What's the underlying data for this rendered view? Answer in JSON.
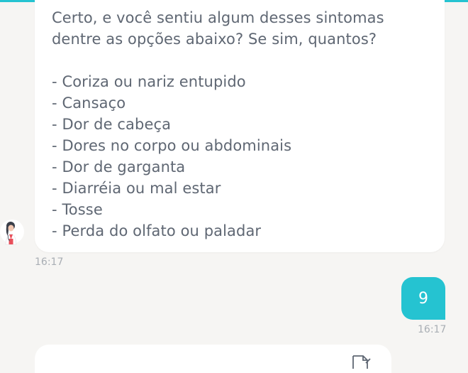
{
  "colors": {
    "accent": "#25c3d1",
    "bot_text": "#5f6773",
    "timestamp": "#a9aeb4",
    "background": "#f6f5f3"
  },
  "bot_message": {
    "question_line1": "Certo, e você sentiu algum desses sintomas",
    "question_line2": "dentre as opções abaixo? Se sim, quantos?",
    "options": [
      "- Coriza ou nariz entupido",
      "- Cansaço",
      "- Dor de cabeça",
      "- Dores no corpo ou abdominais",
      "- Dor de garganta",
      "- Diarréia ou mal estar",
      "- Tosse",
      "- Perda do olfato ou paladar"
    ],
    "time": "16:17",
    "avatar_icon": "doctor-avatar-icon"
  },
  "user_message": {
    "text": "9",
    "time": "16:17"
  },
  "next_message": {
    "icon": "document-icon"
  }
}
